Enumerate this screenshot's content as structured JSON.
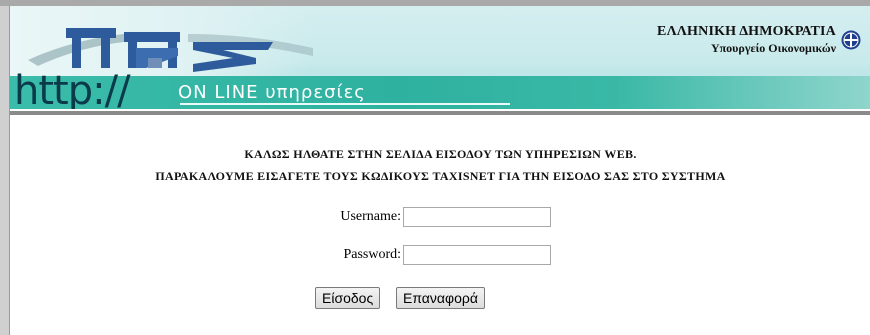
{
  "header": {
    "gov_title": "ΕΛΛΗΝΙΚΗ ΔΗΜΟΚΡΑΤΙΑ",
    "gov_subtitle": "Υπουργείο Οικονομικών",
    "http_text": "http://",
    "online_text": "ON LINE υπηρεσίες",
    "logo_icon": "gsis-logo",
    "emblem_icon": "greek-emblem-icon"
  },
  "main": {
    "welcome_line1": "ΚΑΛΩΣ ΗΛΘΑΤΕ ΣΤΗΝ ΣΕΛΙΔΑ ΕΙΣΟΔΟΥ ΤΩΝ ΥΠΗΡΕΣΙΩΝ WEB.",
    "welcome_line2": "ΠΑΡΑΚΑΛΟΥΜΕ ΕΙΣΑΓΕΤΕ ΤΟΥΣ ΚΩΔΙΚΟΥΣ TAXISNET ΓΙΑ ΤΗΝ ΕΙΣΟΔΟ ΣΑΣ ΣΤΟ ΣΥΣΤΗΜΑ"
  },
  "form": {
    "username_label": "Username:",
    "username_value": "",
    "password_label": "Password:",
    "password_value": "",
    "login_button": "Είσοδος",
    "reset_button": "Επαναφορά"
  }
}
